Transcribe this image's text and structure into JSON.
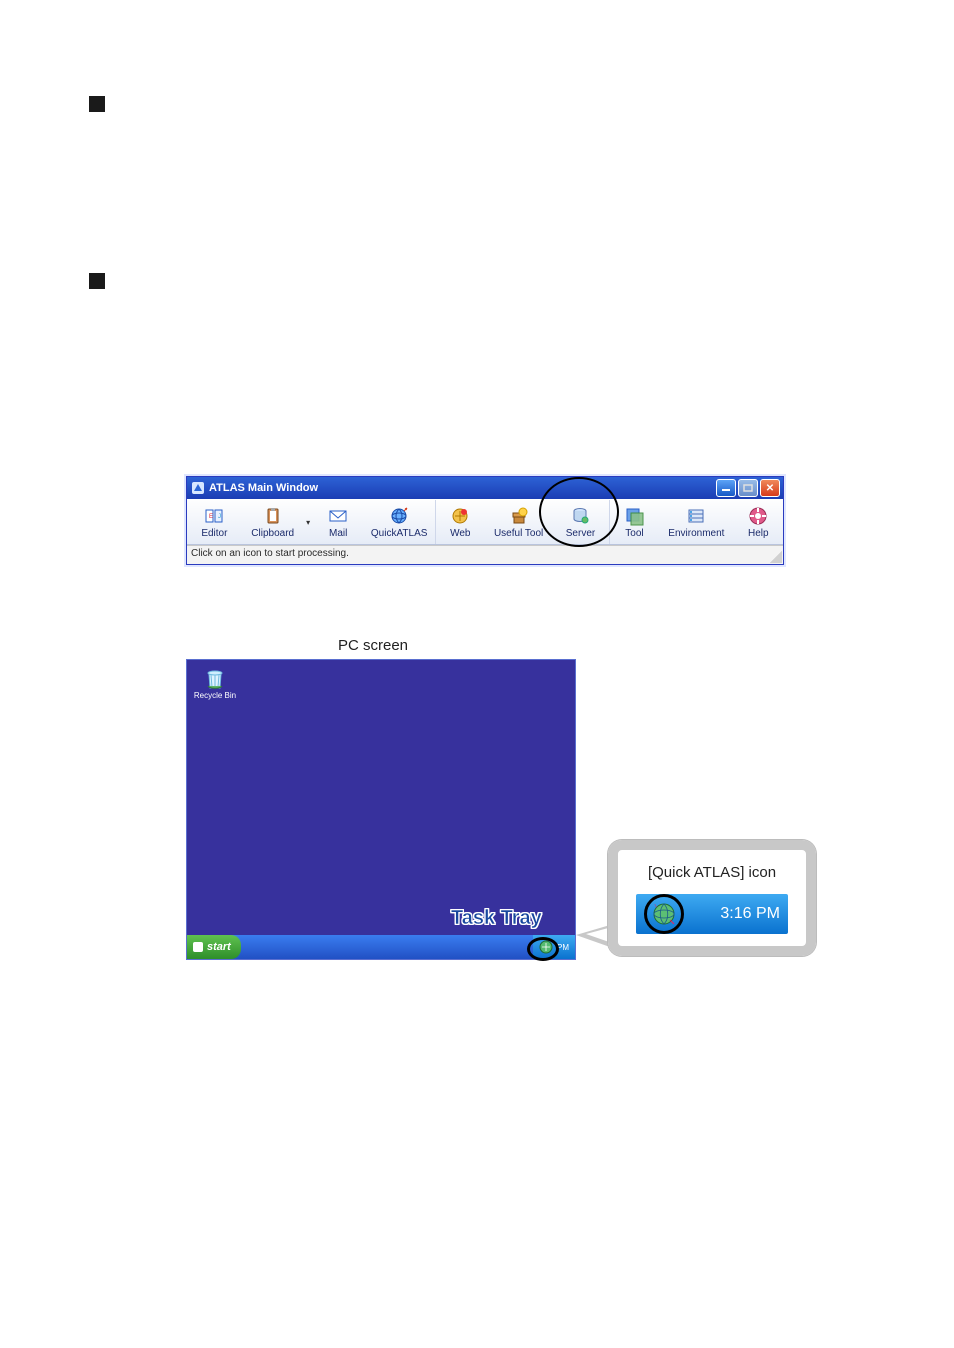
{
  "atlas_window": {
    "title": "ATLAS Main Window",
    "toolbar": [
      {
        "key": "editor",
        "label": "Editor"
      },
      {
        "key": "clipboard",
        "label": "Clipboard"
      },
      {
        "key": "mail",
        "label": "Mail"
      },
      {
        "key": "quickatlas",
        "label": "QuickATLAS"
      },
      {
        "key": "web",
        "label": "Web"
      },
      {
        "key": "usefultool",
        "label": "Useful Tool"
      },
      {
        "key": "server",
        "label": "Server"
      },
      {
        "key": "tool",
        "label": "Tool"
      },
      {
        "key": "environment",
        "label": "Environment"
      },
      {
        "key": "help",
        "label": "Help"
      }
    ],
    "status": "Click on an icon to start processing."
  },
  "desktop": {
    "caption": "PC screen",
    "recycle_label": "Recycle Bin",
    "start_label": "start",
    "tasktray_label": "Task Tray",
    "tray_time_small": "PM"
  },
  "callout": {
    "label": "[Quick ATLAS] icon",
    "time": "3:16 PM"
  }
}
